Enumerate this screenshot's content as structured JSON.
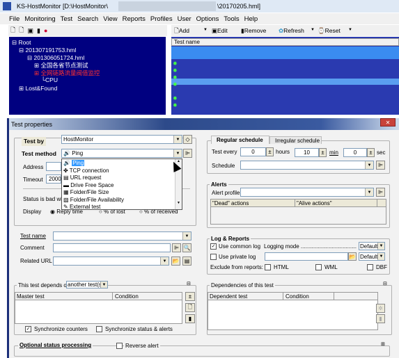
{
  "window": {
    "title_prefix": "KS-HostMonitor  [D:\\HostMonitor\\",
    "title_suffix": "\\20170205.hml]"
  },
  "menu": [
    "File",
    "Monitoring",
    "Test",
    "Search",
    "View",
    "Reports",
    "Profiles",
    "User",
    "Options",
    "Tools",
    "Help"
  ],
  "toolbar": {
    "add": "Add",
    "edit": "Edit",
    "remove": "Remove",
    "refresh": "Refresh",
    "reset": "Reset"
  },
  "tree": {
    "root": "Root",
    "n1": "201307191753.hml",
    "n2": "201306051724.hml",
    "n3": "全国各省节点测试",
    "n4": "全网链路流量阀值监控",
    "n5": "CPU",
    "n6": "Lost&Found"
  },
  "list": {
    "header": "Test name"
  },
  "dialog": {
    "title": "Test properties",
    "test_by_label": "Test by",
    "test_by_value": "HostMonitor",
    "test_method_label": "Test method",
    "test_method_value": "Ping",
    "methods": [
      "Ping",
      "TCP connection",
      "URL request",
      "Drive Free Space",
      "Folder/File Size",
      "Folder/File Availability",
      "External test"
    ],
    "address_label": "Address",
    "timeout_label": "Timeout",
    "timeout_value": "2000",
    "status_label": "Status is bad wh",
    "display_label": "Display",
    "display_options": [
      "Reply time",
      "% of lost",
      "% of received"
    ],
    "test_name_label": "Test name",
    "comment_label": "Comment",
    "related_url_label": "Related URL",
    "schedule_tabs": [
      "Regular schedule",
      "Irregular schedule"
    ],
    "test_every_label": "Test every",
    "hours_value": "0",
    "hours_label": "hours",
    "min_value": "10",
    "min_label": "min",
    "sec_value": "0",
    "sec_label": "sec",
    "schedule_label": "Schedule",
    "alerts_title": "Alerts",
    "alert_profile_label": "Alert profile",
    "dead_actions": "\"Dead\" actions",
    "alive_actions": "\"Alive actions\"",
    "log_title": "Log & Reports",
    "use_common_log": "Use common log",
    "logging_mode": "Logging mode ..........................................",
    "default1": "Default",
    "use_private_log": "Use private log",
    "default2": "Default",
    "exclude_label": "Exclude from reports:",
    "html": "HTML",
    "wml": "WML",
    "dbf": "DBF",
    "depends_label": "This test depends on",
    "depends_value": "another test(s)",
    "master_test": "Master test",
    "condition1": "Condition",
    "sync_counters": "Synchronize counters",
    "sync_status": "Synchronize status & alerts",
    "dependencies_title": "Dependencies of this test",
    "dependent_test": "Dependent test",
    "condition2": "Condition",
    "optional_title": "Optional status processing",
    "reverse_alert": "Reverse alert"
  },
  "colors": {
    "tree_bg": "#000080",
    "selection": "#3399ff",
    "dialog_bg": "#f2f2f2"
  }
}
